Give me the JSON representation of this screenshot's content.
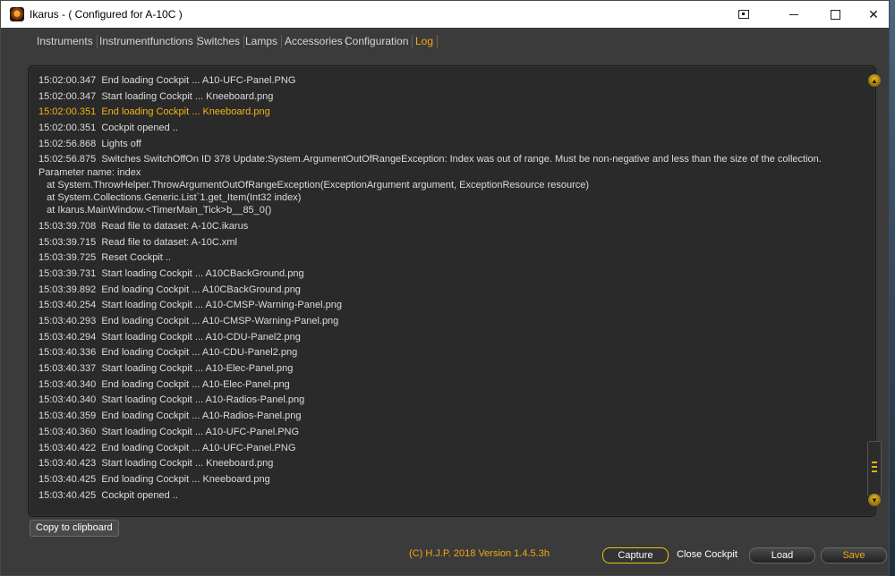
{
  "window": {
    "title": "Ikarus - ( Configured for A-10C )"
  },
  "tabs": [
    {
      "label": "Instruments",
      "active": false
    },
    {
      "label": "Instrumentfunctions",
      "active": false
    },
    {
      "label": "Switches",
      "active": false
    },
    {
      "label": "Lamps",
      "active": false
    },
    {
      "label": "Accessories",
      "active": false
    },
    {
      "label": "Configuration",
      "active": false
    },
    {
      "label": "Log",
      "active": true
    }
  ],
  "log": [
    {
      "text": "15:02:00.347  End loading Cockpit ... A10-UFC-Panel.PNG",
      "highlight": false
    },
    {
      "text": "15:02:00.347  Start loading Cockpit ... Kneeboard.png",
      "highlight": false
    },
    {
      "text": "15:02:00.351  End loading Cockpit ... Kneeboard.png",
      "highlight": true
    },
    {
      "text": "15:02:00.351  Cockpit opened ..",
      "highlight": false
    },
    {
      "text": "15:02:56.868  Lights off",
      "highlight": false
    },
    {
      "text": "15:02:56.875  Switches SwitchOffOn ID 378 Update:System.ArgumentOutOfRangeException: Index was out of range. Must be non-negative and less than the size of the collection.",
      "highlight": false,
      "cont": true
    },
    {
      "text": "Parameter name: index",
      "highlight": false,
      "cont": true
    },
    {
      "text": "   at System.ThrowHelper.ThrowArgumentOutOfRangeException(ExceptionArgument argument, ExceptionResource resource)",
      "highlight": false,
      "cont": true
    },
    {
      "text": "   at System.Collections.Generic.List`1.get_Item(Int32 index)",
      "highlight": false,
      "cont": true
    },
    {
      "text": "   at Ikarus.MainWindow.<TimerMain_Tick>b__85_0()",
      "highlight": false
    },
    {
      "text": "15:03:39.708  Read file to dataset: A-10C.ikarus",
      "highlight": false
    },
    {
      "text": "15:03:39.715  Read file to dataset: A-10C.xml",
      "highlight": false
    },
    {
      "text": "15:03:39.725  Reset Cockpit ..",
      "highlight": false
    },
    {
      "text": "15:03:39.731  Start loading Cockpit ... A10CBackGround.png",
      "highlight": false
    },
    {
      "text": "15:03:39.892  End loading Cockpit ... A10CBackGround.png",
      "highlight": false
    },
    {
      "text": "15:03:40.254  Start loading Cockpit ... A10-CMSP-Warning-Panel.png",
      "highlight": false
    },
    {
      "text": "15:03:40.293  End loading Cockpit ... A10-CMSP-Warning-Panel.png",
      "highlight": false
    },
    {
      "text": "15:03:40.294  Start loading Cockpit ... A10-CDU-Panel2.png",
      "highlight": false
    },
    {
      "text": "15:03:40.336  End loading Cockpit ... A10-CDU-Panel2.png",
      "highlight": false
    },
    {
      "text": "15:03:40.337  Start loading Cockpit ... A10-Elec-Panel.png",
      "highlight": false
    },
    {
      "text": "15:03:40.340  End loading Cockpit ... A10-Elec-Panel.png",
      "highlight": false
    },
    {
      "text": "15:03:40.340  Start loading Cockpit ... A10-Radios-Panel.png",
      "highlight": false
    },
    {
      "text": "15:03:40.359  End loading Cockpit ... A10-Radios-Panel.png",
      "highlight": false
    },
    {
      "text": "15:03:40.360  Start loading Cockpit ... A10-UFC-Panel.PNG",
      "highlight": false
    },
    {
      "text": "15:03:40.422  End loading Cockpit ... A10-UFC-Panel.PNG",
      "highlight": false
    },
    {
      "text": "15:03:40.423  Start loading Cockpit ... Kneeboard.png",
      "highlight": false
    },
    {
      "text": "15:03:40.425  End loading Cockpit ... Kneeboard.png",
      "highlight": false
    },
    {
      "text": "15:03:40.425  Cockpit opened ..",
      "highlight": false
    }
  ],
  "buttons": {
    "copy": "Copy to clipboard",
    "capture": "Capture",
    "close_cockpit": "Close Cockpit",
    "load": "Load",
    "save": "Save"
  },
  "footer": {
    "version": "(C) H.J.P. 2018  Version 1.4.5.3h"
  },
  "colors": {
    "accent": "#f2a813",
    "background": "#3b3b3b",
    "log_background": "#2a2a2a",
    "log_text": "#dcdcdc"
  }
}
